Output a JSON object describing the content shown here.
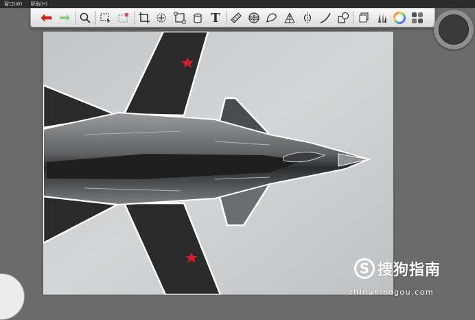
{
  "menubar": {
    "items": [
      {
        "label": "窗口(W)"
      },
      {
        "label": "帮助(H)"
      }
    ]
  },
  "toolbar": {
    "tools": [
      {
        "name": "undo-icon"
      },
      {
        "name": "redo-icon"
      },
      {
        "name": "magnifier-icon"
      },
      {
        "name": "selection-rect-icon"
      },
      {
        "name": "selection-clear-icon"
      },
      {
        "name": "crop-icon"
      },
      {
        "name": "lasso-move-icon"
      },
      {
        "name": "transform-icon"
      },
      {
        "name": "fill-bucket-icon"
      },
      {
        "name": "text-icon"
      },
      {
        "name": "ruler-icon"
      },
      {
        "name": "ellipse-guide-icon"
      },
      {
        "name": "french-curve-icon"
      },
      {
        "name": "perspective-guide-icon"
      },
      {
        "name": "symmetry-icon"
      },
      {
        "name": "curve-stroke-icon"
      },
      {
        "name": "shapes-icon"
      },
      {
        "name": "layers-icon"
      },
      {
        "name": "brush-library-icon"
      },
      {
        "name": "color-wheel-icon"
      },
      {
        "name": "copic-library-icon"
      }
    ],
    "text_tool_glyph": "T",
    "accent_undo": "#d9281b",
    "accent_redo": "#8cc98f"
  },
  "canvas": {
    "background": "#c9cbcc",
    "content": "aircraft-drawing"
  },
  "watermark": {
    "logo_char": "S",
    "text": "搜狗指南",
    "url": "zhinan.sogou.com"
  }
}
